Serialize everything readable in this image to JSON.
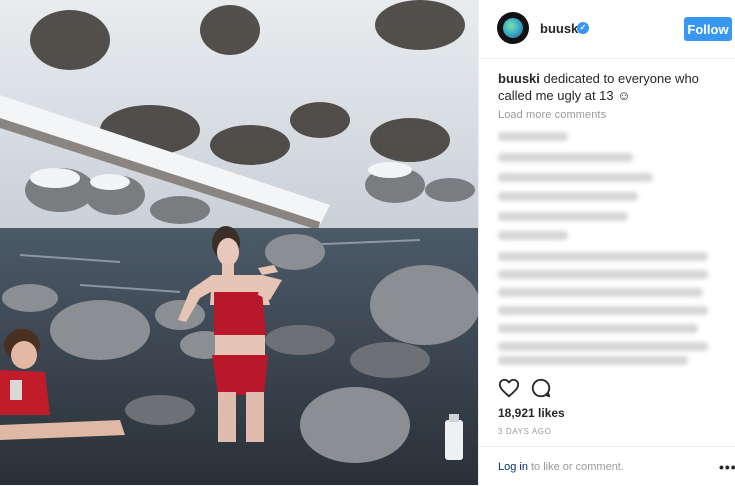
{
  "post": {
    "username": "buuski",
    "verified_mark": "✓",
    "follow_label": "Follow",
    "caption_username": "buuski",
    "caption_text": " dedicated to everyone who called me ugly at 13 ☺",
    "load_more_label": "Load more comments",
    "likes": "18,921 likes",
    "timestamp": "3 DAYS AGO",
    "login_label": "Log in",
    "login_suffix": "to like or comment.",
    "more_label": "•••"
  },
  "colors": {
    "accent": "#3897f0",
    "muted_text": "#999999",
    "text": "#262626",
    "link": "#003569"
  },
  "icons": {
    "heart": "heart-icon",
    "comment": "comment-bubble-icon",
    "more": "more-options-icon",
    "verified": "verified-badge-icon"
  }
}
